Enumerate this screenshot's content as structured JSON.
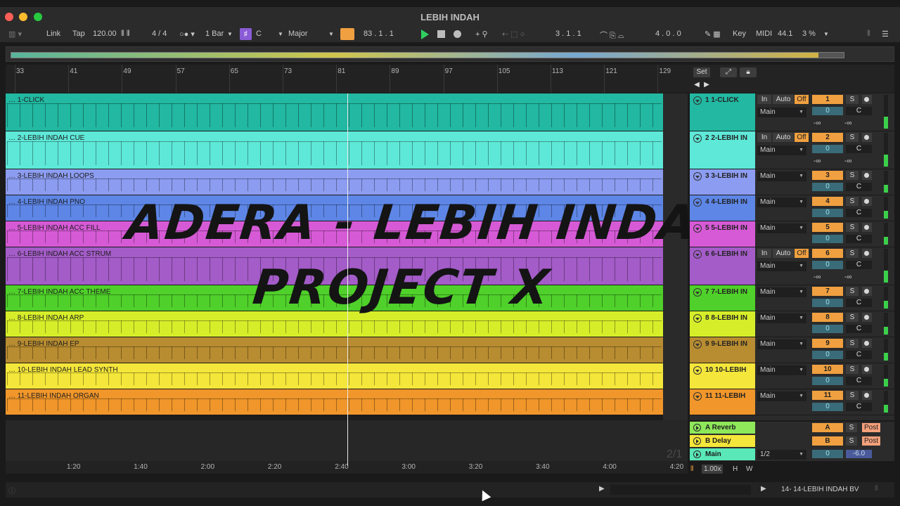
{
  "window": {
    "title": "LEBIH INDAH"
  },
  "toolbar": {
    "link": "Link",
    "tap": "Tap",
    "tempo": "120.00",
    "signature": "4 / 4",
    "quantize": "1 Bar",
    "key_icon": "♯",
    "key": "C",
    "scale": "Major",
    "position": "83 . 1 . 1",
    "loop_start": "3 . 1 . 1",
    "loop_length": "4 . 0 . 0",
    "key_label": "Key",
    "midi_label": "MIDI",
    "sample_rate": "44.1",
    "cpu": "3 %"
  },
  "ruler": {
    "bars": [
      "33",
      "41",
      "49",
      "57",
      "65",
      "73",
      "81",
      "89",
      "97",
      "105",
      "113",
      "121",
      "129"
    ]
  },
  "time_ruler": {
    "times": [
      "1:20",
      "1:40",
      "2:00",
      "2:20",
      "2:40",
      "3:00",
      "3:20",
      "3:40",
      "4:00",
      "4:20"
    ]
  },
  "pager": "2/1",
  "overlay": {
    "line1": "ADERA - LEBIH INDAH",
    "line2": "PROJECT X"
  },
  "tracks": [
    {
      "name": "1-CLICK",
      "color": "#22b8a2",
      "mixer_label": "1   1-CLICK",
      "number": "1",
      "vol": "0",
      "has_input": true
    },
    {
      "name": "2-LEBIH INDAH CUE",
      "color": "#5ee8d8",
      "mixer_label": "2   2-LEBIH IN",
      "number": "2",
      "vol": "0",
      "has_input": true
    },
    {
      "name": "3-LEBIH INDAH LOOPS",
      "color": "#8c9cf0",
      "mixer_label": "3   3-LEBIH IN",
      "number": "3",
      "vol": "0",
      "has_input": false
    },
    {
      "name": "4-LEBIH INDAH PNO",
      "color": "#5d86e6",
      "mixer_label": "4   4-LEBIH IN",
      "number": "4",
      "vol": "0",
      "has_input": false
    },
    {
      "name": "5-LEBIH INDAH ACC FILL",
      "color": "#d65ad6",
      "mixer_label": "5   5-LEBIH IN",
      "number": "5",
      "vol": "0",
      "has_input": false
    },
    {
      "name": "6-LEBIH INDAH ACC STRUM",
      "color": "#a45cc8",
      "mixer_label": "6   6-LEBIH IN",
      "number": "6",
      "vol": "0",
      "has_input": true
    },
    {
      "name": "7-LEBIH INDAH ACC THEME",
      "color": "#4fd02a",
      "mixer_label": "7   7-LEBIH IN",
      "number": "7",
      "vol": "0",
      "has_input": false
    },
    {
      "name": "8-LEBIH INDAH ARP",
      "color": "#d6ee2a",
      "mixer_label": "8   8-LEBIH IN",
      "number": "8",
      "vol": "0",
      "has_input": false
    },
    {
      "name": "9-LEBIH INDAH EP",
      "color": "#b88c30",
      "mixer_label": "9   9-LEBIH IN",
      "number": "9",
      "vol": "0",
      "has_input": false
    },
    {
      "name": "10-LEBIH INDAH LEAD SYNTH",
      "color": "#f4e63a",
      "mixer_label": "10   10-LEBIH",
      "number": "10",
      "vol": "0",
      "has_input": false
    },
    {
      "name": "11-LEBIH INDAH ORGAN",
      "color": "#f0962a",
      "mixer_label": "11   11-LEBIH",
      "number": "11",
      "vol": "0",
      "has_input": false
    }
  ],
  "mixer": {
    "set": "Set",
    "output": "Main",
    "in": "In",
    "auto": "Auto",
    "off": "Off",
    "solo": "S",
    "center": "C",
    "neg_inf": "-∞"
  },
  "returns": [
    {
      "name": "A Reverb",
      "color": "#8ee85a",
      "letter": "A",
      "post": "Post"
    },
    {
      "name": "B Delay",
      "color": "#f4e63a",
      "letter": "B",
      "post": "Post"
    },
    {
      "name": "Main",
      "color": "#5ae8b8",
      "letter": "0",
      "post": "",
      "cue": "1/2",
      "vol": "-6.0"
    }
  ],
  "bottom": {
    "zoom": "1.00x",
    "h": "H",
    "w": "W"
  },
  "status": {
    "selected": "14- 14-LEBIH INDAH BV"
  }
}
